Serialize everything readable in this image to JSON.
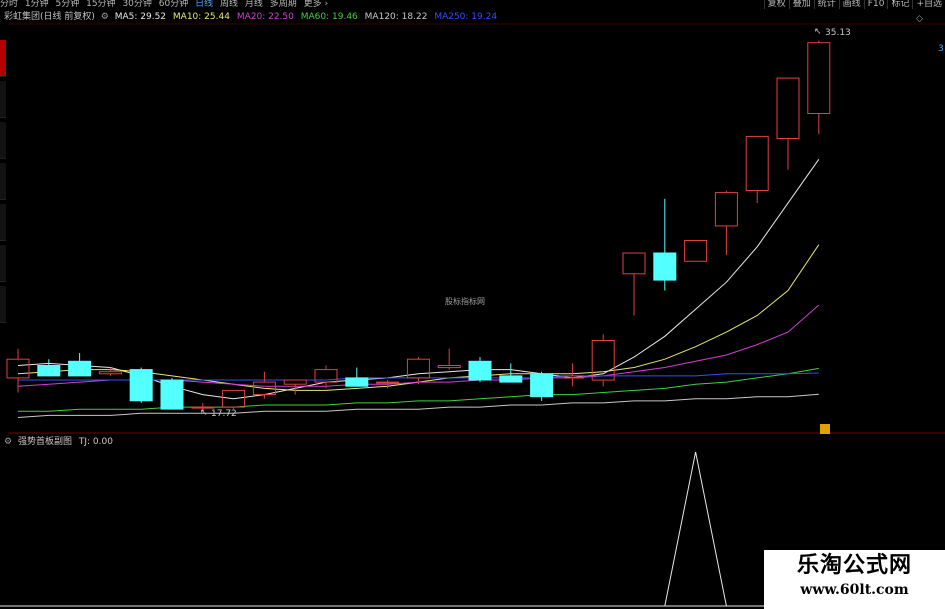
{
  "tabs": [
    "分时",
    "1分钟",
    "5分钟",
    "15分钟",
    "30分钟",
    "60分钟",
    "日线",
    "周线",
    "月线",
    "多周期",
    "更多 ›"
  ],
  "active_tab_index": 6,
  "right_buttons": [
    "复权",
    "叠加",
    "统计",
    "画线",
    "F10",
    "标记",
    "+自选"
  ],
  "title": {
    "stock": "彩虹集团(日线 前复权)"
  },
  "ma_legend": [
    {
      "label": "MA5: 29.52",
      "color": "#e8e8e8"
    },
    {
      "label": "MA10: 25.44",
      "color": "#e8e870"
    },
    {
      "label": "MA20: 22.50",
      "color": "#d040d0"
    },
    {
      "label": "MA60: 19.46",
      "color": "#40d040"
    },
    {
      "label": "MA120: 18.22",
      "color": "#c8c8c8"
    },
    {
      "label": "MA250: 19.24",
      "color": "#3050ff"
    }
  ],
  "price_high_label": "35.13",
  "price_low_label": "17.72",
  "center_mark": "股标指标网",
  "right_edge_number": "3",
  "sub_indicator": {
    "name": "强势首板副图",
    "value_label": "TJ: 0.00"
  },
  "watermark": {
    "line1": "乐淘公式网",
    "line2": "www.60lt.com"
  },
  "colors": {
    "up": "#e04040",
    "down": "#54ffff",
    "ma5": "#e8e8e8",
    "ma10": "#e8e870",
    "ma20": "#d040d0",
    "ma60": "#40d040",
    "ma120": "#c8c8c8",
    "ma250": "#3050ff",
    "accent_tab": "#4da6ff",
    "sidebar_active": "#b40000"
  },
  "chart_data": {
    "type": "candlestick",
    "ylim": [
      16.5,
      36
    ],
    "candles": [
      {
        "o": 19.0,
        "h": 20.4,
        "l": 18.3,
        "c": 19.9
      },
      {
        "o": 19.6,
        "h": 19.9,
        "l": 19.1,
        "c": 19.1
      },
      {
        "o": 19.8,
        "h": 20.2,
        "l": 19.2,
        "c": 19.1
      },
      {
        "o": 19.2,
        "h": 19.5,
        "l": 19.1,
        "c": 19.3
      },
      {
        "o": 19.4,
        "h": 19.5,
        "l": 17.8,
        "c": 17.9
      },
      {
        "o": 18.9,
        "h": 19.0,
        "l": 17.6,
        "c": 17.5
      },
      {
        "o": 17.6,
        "h": 17.8,
        "l": 17.4,
        "c": 17.6
      },
      {
        "o": 17.6,
        "h": 18.2,
        "l": 17.5,
        "c": 18.4
      },
      {
        "o": 18.2,
        "h": 19.3,
        "l": 18.0,
        "c": 18.8
      },
      {
        "o": 18.7,
        "h": 18.9,
        "l": 18.2,
        "c": 18.9
      },
      {
        "o": 18.8,
        "h": 19.6,
        "l": 18.5,
        "c": 19.4
      },
      {
        "o": 19.0,
        "h": 19.5,
        "l": 19.0,
        "c": 18.6
      },
      {
        "o": 18.8,
        "h": 18.9,
        "l": 18.5,
        "c": 18.8
      },
      {
        "o": 19.0,
        "h": 20.0,
        "l": 18.7,
        "c": 19.9
      },
      {
        "o": 19.5,
        "h": 20.4,
        "l": 19.4,
        "c": 19.6
      },
      {
        "o": 19.8,
        "h": 20.0,
        "l": 18.8,
        "c": 18.9
      },
      {
        "o": 19.1,
        "h": 19.7,
        "l": 18.9,
        "c": 18.8
      },
      {
        "o": 19.2,
        "h": 19.3,
        "l": 17.9,
        "c": 18.1
      },
      {
        "o": 19.0,
        "h": 19.7,
        "l": 18.6,
        "c": 19.1
      },
      {
        "o": 18.9,
        "h": 21.1,
        "l": 18.6,
        "c": 20.8
      },
      {
        "o": 24.0,
        "h": 24.0,
        "l": 22.0,
        "c": 25.0
      },
      {
        "o": 25.0,
        "h": 27.6,
        "l": 23.2,
        "c": 23.7
      },
      {
        "o": 24.6,
        "h": 25.4,
        "l": 24.6,
        "c": 25.6
      },
      {
        "o": 26.3,
        "h": 28.0,
        "l": 24.9,
        "c": 27.9
      },
      {
        "o": 28.0,
        "h": 30.0,
        "l": 27.4,
        "c": 30.6
      },
      {
        "o": 30.5,
        "h": 33.3,
        "l": 29.0,
        "c": 33.4
      },
      {
        "o": 31.7,
        "h": 35.2,
        "l": 30.7,
        "c": 35.1
      }
    ],
    "ma_series": [
      {
        "name": "MA5",
        "values": [
          19.6,
          19.7,
          19.6,
          19.5,
          19.1,
          18.6,
          18.2,
          18.0,
          18.2,
          18.5,
          18.8,
          18.9,
          19.0,
          19.2,
          19.3,
          19.4,
          19.4,
          19.2,
          19.0,
          19.2,
          20.0,
          21.0,
          22.3,
          23.6,
          25.3,
          27.4,
          29.5
        ]
      },
      {
        "name": "MA10",
        "values": [
          19.2,
          19.3,
          19.4,
          19.4,
          19.3,
          19.1,
          18.9,
          18.7,
          18.5,
          18.4,
          18.4,
          18.5,
          18.6,
          18.8,
          19.0,
          19.1,
          19.2,
          19.2,
          19.2,
          19.3,
          19.5,
          19.9,
          20.5,
          21.2,
          22.0,
          23.2,
          25.4
        ]
      },
      {
        "name": "MA20",
        "values": [
          18.6,
          18.7,
          18.8,
          18.9,
          18.9,
          18.9,
          18.8,
          18.7,
          18.6,
          18.6,
          18.6,
          18.7,
          18.7,
          18.8,
          18.8,
          18.9,
          18.9,
          19.0,
          19.0,
          19.1,
          19.3,
          19.5,
          19.8,
          20.1,
          20.6,
          21.2,
          22.5
        ]
      },
      {
        "name": "MA60",
        "values": [
          17.4,
          17.4,
          17.5,
          17.5,
          17.5,
          17.6,
          17.6,
          17.6,
          17.7,
          17.7,
          17.7,
          17.8,
          17.8,
          17.9,
          17.9,
          18.0,
          18.1,
          18.2,
          18.2,
          18.3,
          18.4,
          18.5,
          18.7,
          18.8,
          19.0,
          19.2,
          19.46
        ]
      },
      {
        "name": "MA120",
        "values": [
          17.1,
          17.2,
          17.2,
          17.2,
          17.3,
          17.3,
          17.3,
          17.3,
          17.4,
          17.4,
          17.4,
          17.5,
          17.5,
          17.5,
          17.6,
          17.6,
          17.7,
          17.7,
          17.8,
          17.8,
          17.9,
          17.9,
          18.0,
          18.0,
          18.1,
          18.1,
          18.22
        ]
      },
      {
        "name": "MA250",
        "values": [
          18.9,
          18.9,
          18.9,
          18.9,
          18.9,
          18.9,
          18.9,
          18.9,
          18.9,
          18.9,
          18.9,
          19.0,
          19.0,
          19.0,
          19.0,
          19.0,
          19.0,
          19.0,
          19.1,
          19.1,
          19.1,
          19.1,
          19.1,
          19.2,
          19.2,
          19.2,
          19.24
        ]
      }
    ],
    "sub_series": {
      "name": "TJ",
      "values": [
        0,
        0,
        0,
        0,
        0,
        0,
        0,
        0,
        0,
        0,
        0,
        0,
        0,
        0,
        0,
        0,
        0,
        0,
        0,
        0,
        0,
        0,
        1,
        0,
        0,
        0,
        0
      ]
    }
  }
}
